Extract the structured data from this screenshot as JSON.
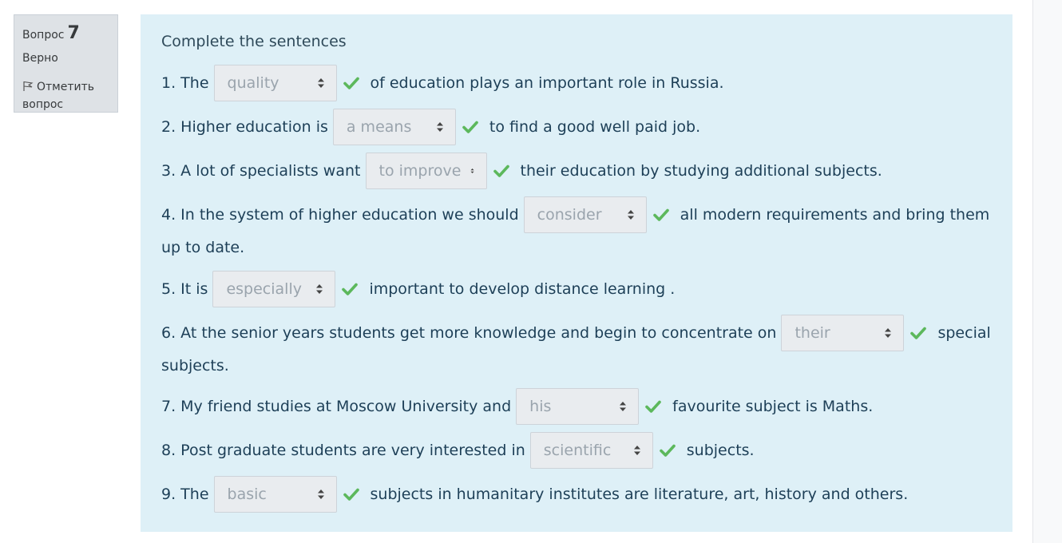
{
  "info": {
    "question_label": "Вопрос",
    "question_number": "7",
    "state": "Верно",
    "flag_label": "Отметить вопрос"
  },
  "question": {
    "title": "Complete the sentences",
    "lines": [
      {
        "before": "1. The",
        "select": "quality",
        "after": "of education plays an important role in Russia."
      },
      {
        "before": "2. Higher education is",
        "select": "a means",
        "after": "to find a good well paid job."
      },
      {
        "before": "3. A lot of specialists want",
        "select": "to improve",
        "after": "their education by studying additional subjects."
      },
      {
        "before": "4. In the system of higher education we should",
        "select": "consider",
        "after": "all modern requirements and bring them",
        "continuation": "up to date."
      },
      {
        "before": "5. It is",
        "select": "especially",
        "after": "important to develop distance learning ."
      },
      {
        "before": "6. At the senior years students get more knowledge and begin to concentrate on",
        "select": "their",
        "after": "special",
        "continuation": "subjects."
      },
      {
        "before": "7. My friend studies at Moscow University and",
        "select": "his",
        "after": "favourite subject is Maths."
      },
      {
        "before": "8. Post graduate students are very interested in",
        "select": "scientific",
        "after": "subjects."
      },
      {
        "before": "9. The",
        "select": "basic",
        "after": "subjects in humanitary institutes are literature, art, history and others."
      }
    ]
  },
  "colors": {
    "content_bg": "#def0f7",
    "check": "#5cb85c",
    "select_bg": "#e9ecef"
  }
}
